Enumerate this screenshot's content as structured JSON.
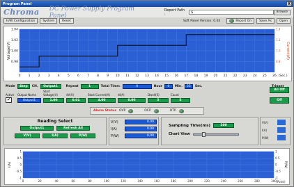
{
  "window": {
    "title": "Program Panel",
    "close": "X"
  },
  "header": {
    "brand": "Chroma",
    "title": "DC Power Supply Program Panel",
    "report_label": "Report Path :",
    "report_value": "$",
    "browse": "Browse"
  },
  "menu": {
    "buttons": [
      "H/W Configuration",
      "System",
      "Reset"
    ],
    "version_label": "Soft Panel Version: 0.03",
    "report_on": "Report On",
    "save_as": "Save As",
    "open": "Open"
  },
  "chart_data": [
    {
      "type": "line",
      "ylabel": "Voltage(V)",
      "ylabel_right": "Current(A)",
      "xlabel": "(Sec.)",
      "x_ticks": [
        0,
        1,
        2,
        3,
        4,
        5,
        6,
        7,
        8,
        9,
        10,
        11,
        12,
        13,
        14,
        15,
        16,
        17,
        18,
        19,
        20,
        21,
        22,
        23,
        24,
        25,
        26
      ],
      "y_ticks": [
        "1.04",
        "1.02",
        "1.00",
        "0.98"
      ],
      "y2_ticks": [
        "1.4",
        "1.2",
        "1.0",
        "0.8"
      ],
      "series": [
        {
          "values_x": [
            0,
            2,
            2,
            10,
            10,
            17,
            17,
            26
          ],
          "values_y": [
            0.97,
            0.97,
            0.99,
            0.99,
            1.01,
            1.01,
            1.03,
            1.03
          ]
        }
      ]
    },
    {
      "type": "line",
      "ylabel": "I(A)",
      "ylabel_right": "P(W)",
      "xlabel": "(Point)",
      "x_ticks": [
        0,
        20,
        40,
        60,
        80,
        100,
        120,
        140,
        160,
        180,
        200,
        220,
        240,
        260,
        280,
        300
      ],
      "y_ticks": [
        "1",
        "0.5",
        "0",
        "-0.5",
        "-1"
      ],
      "y2_ticks": [
        "1",
        "0.5",
        "0",
        "-0.5",
        "-1"
      ]
    }
  ],
  "controls": {
    "mode_label": "Mode",
    "mode": "Step",
    "ch_label": "CH.",
    "ch": "Output1",
    "repeat_label": "Repeat",
    "repeat": "1",
    "total_label": "Total Time:",
    "hour": "0",
    "hour_label": "Hour",
    "min": "0",
    "min_label": "Min.",
    "sec": "25",
    "sec_label": "Sec.",
    "trigger": "Trigger"
  },
  "steps": {
    "headers": [
      "Active",
      "Output Name",
      "Start Voltage(V)",
      "dV(V)",
      "Start Current(A)",
      "dI(A)",
      "Dwell(S)",
      "Count"
    ],
    "row": [
      "Output1",
      "1.00",
      "0.01",
      "4.00",
      "0.00",
      "5",
      "5"
    ],
    "all_off": "All Off",
    "off": "Off"
  },
  "alarm": {
    "label": "Alarm Status",
    "ovp": "OVP",
    "ocp": "OCP",
    "otp": "OTP"
  },
  "reading": {
    "title": "Reading Select",
    "output": "Output1",
    "refresh": "Refresh All",
    "v": "V(V)",
    "i": "I(A)",
    "p": "P(W)"
  },
  "values": {
    "v_label": "V(V)",
    "i_label": "I(A)",
    "p_label": "P(W)",
    "v": "0.00",
    "i": "0.00",
    "p": "0.00"
  },
  "sampling": {
    "label": "Sampling Time(ms)",
    "value": "200",
    "chart_view": "Chart View"
  },
  "legend": {
    "v": "V(V)",
    "i": "I(A)",
    "p": "P(W)"
  }
}
